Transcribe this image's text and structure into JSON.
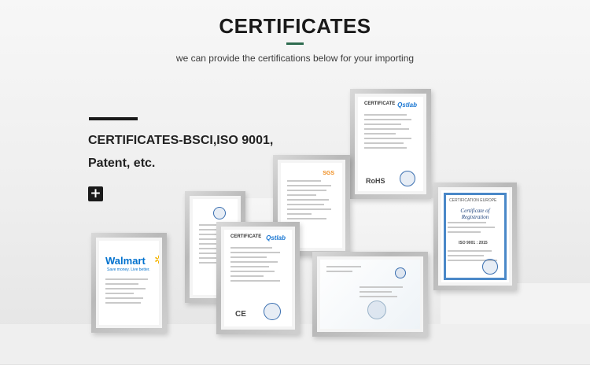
{
  "header": {
    "title": "CERTIFICATES",
    "subtitle": "we can provide the certifications below for your importing"
  },
  "side": {
    "heading": "CERTIFICATES-BSCI,ISO 9001, Patent, etc.",
    "expand_icon": "plus-icon",
    "expand_glyph": "+"
  },
  "certificates": {
    "walmart": {
      "logo": "Walmart",
      "tagline": "Save money. Live better."
    },
    "qstlab_center": {
      "title": "CERTIFICATE",
      "logo": "Qstlab",
      "mark": "CE"
    },
    "qstlab_top": {
      "title": "CERTIFICATE",
      "logo": "Qstlab",
      "mark": "RoHS"
    },
    "sgs": {
      "logo": "SGS"
    },
    "iso": {
      "header": "CERTIFICATION EUROPE",
      "title": "Certificate of Registration",
      "code": "ISO 9001 : 2015"
    }
  },
  "colors": {
    "accent": "#2e6b4f",
    "title": "#1a1a1a",
    "walmart_blue": "#0071ce",
    "qstlab_blue": "#1976d2"
  }
}
